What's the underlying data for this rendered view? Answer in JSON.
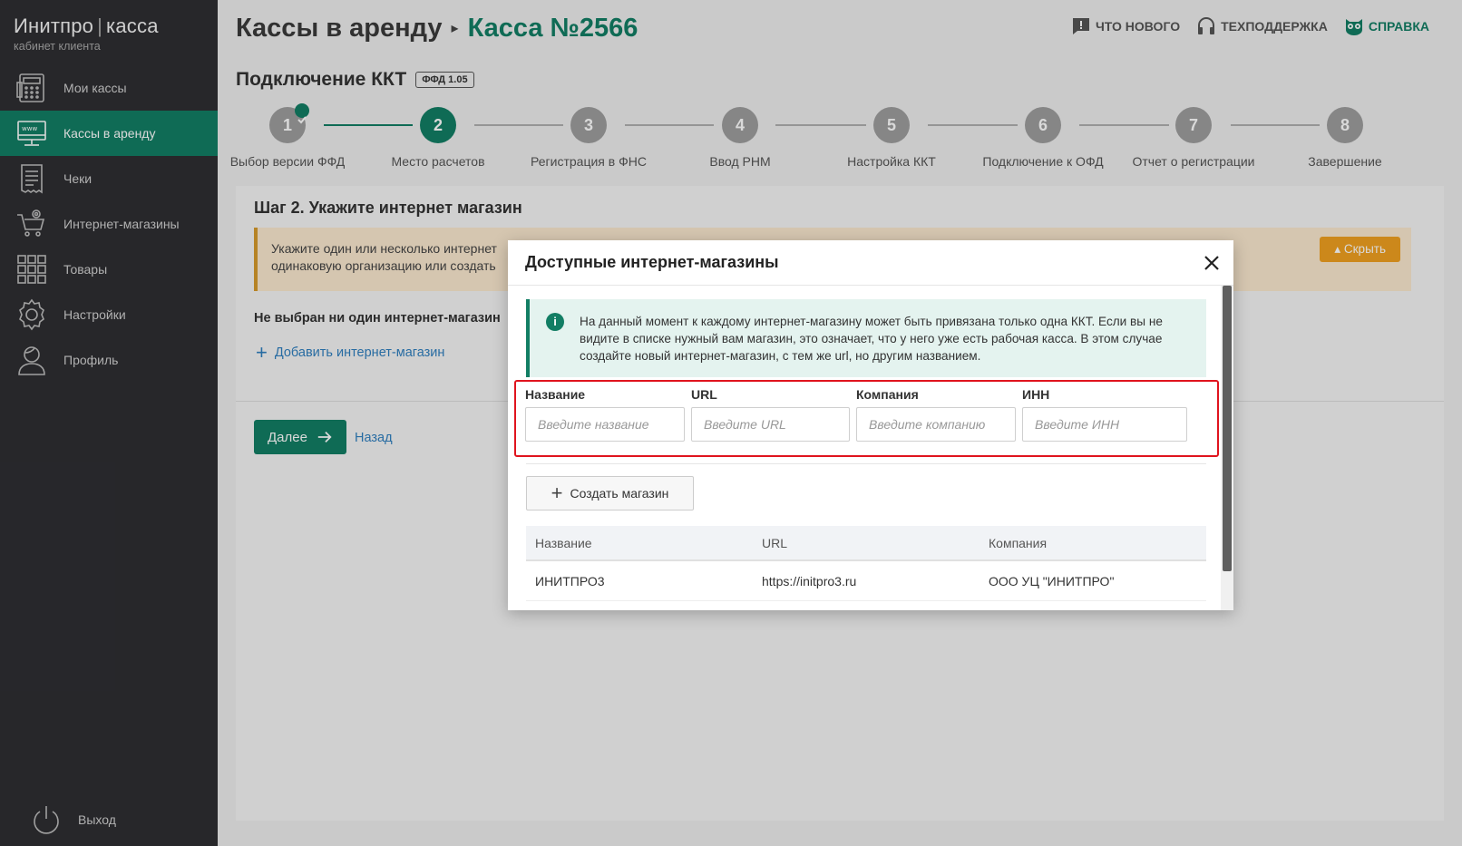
{
  "brand": {
    "name": "Инитпро",
    "separator": "|",
    "product": "касса",
    "subtitle": "кабинет клиента"
  },
  "sidebar": {
    "items": [
      {
        "label": "Мои кассы",
        "icon": "cash-register-icon",
        "active": false
      },
      {
        "label": "Кассы в аренду",
        "icon": "monitor-www-icon",
        "active": true
      },
      {
        "label": "Чеки",
        "icon": "receipt-icon",
        "active": false
      },
      {
        "label": "Интернет-магазины",
        "icon": "cart-at-icon",
        "active": false
      },
      {
        "label": "Товары",
        "icon": "grid-icon",
        "active": false
      },
      {
        "label": "Настройки",
        "icon": "gear-icon",
        "active": false
      },
      {
        "label": "Профиль",
        "icon": "user-icon",
        "active": false
      }
    ],
    "logout": "Выход"
  },
  "header": {
    "crumb1": "Кассы в аренду",
    "crumb2": "Касса №2566",
    "links": {
      "news": "ЧТО НОВОГО",
      "support": "ТЕХПОДДЕРЖКА",
      "help": "СПРАВКА"
    }
  },
  "section": {
    "title": "Подключение ККТ",
    "badge": "ФФД 1.05"
  },
  "steps": [
    {
      "num": "1",
      "label": "Выбор версии ФФД",
      "done": true
    },
    {
      "num": "2",
      "label": "Место расчетов",
      "current": true
    },
    {
      "num": "3",
      "label": "Регистрация в ФНС"
    },
    {
      "num": "4",
      "label": "Ввод РНМ"
    },
    {
      "num": "5",
      "label": "Настройка ККТ"
    },
    {
      "num": "6",
      "label": "Подключение к ОФД"
    },
    {
      "num": "7",
      "label": "Отчет о регистрации"
    },
    {
      "num": "8",
      "label": "Завершение"
    }
  ],
  "card": {
    "title": "Шаг 2. Укажите интернет магазин",
    "warning": "Укажите один или несколько интернет одинаковую организацию или создать",
    "hide_button": "Скрыть",
    "no_shop": "Не выбран ни один интернет-магазин",
    "add_shop": "Добавить интернет-магазин",
    "next": "Далее",
    "back": "Назад"
  },
  "modal": {
    "title": "Доступные интернет-магазины",
    "info": "На данный момент к каждому интернет-магазину может быть привязана только одна ККТ. Если вы не видите в списке нужный вам магазин, это означает, что у него уже есть рабочая касса. В этом случае создайте новый интернет-магазин, с тем же url, но другим названием.",
    "filters": {
      "name_label": "Название",
      "name_placeholder": "Введите название",
      "url_label": "URL",
      "url_placeholder": "Введите URL",
      "company_label": "Компания",
      "company_placeholder": "Введите компанию",
      "inn_label": "ИНН",
      "inn_placeholder": "Введите ИНН"
    },
    "create_button": "Создать магазин",
    "table": {
      "headers": [
        "Название",
        "URL",
        "Компания"
      ],
      "rows": [
        [
          "ИНИТПРО3",
          "https://initpro3.ru",
          "ООО УЦ \"ИНИТПРО\""
        ]
      ]
    }
  },
  "colors": {
    "accent": "#127e64",
    "sidebar": "#2e2e32",
    "warning": "#f0a020",
    "highlight": "#e0141e"
  }
}
